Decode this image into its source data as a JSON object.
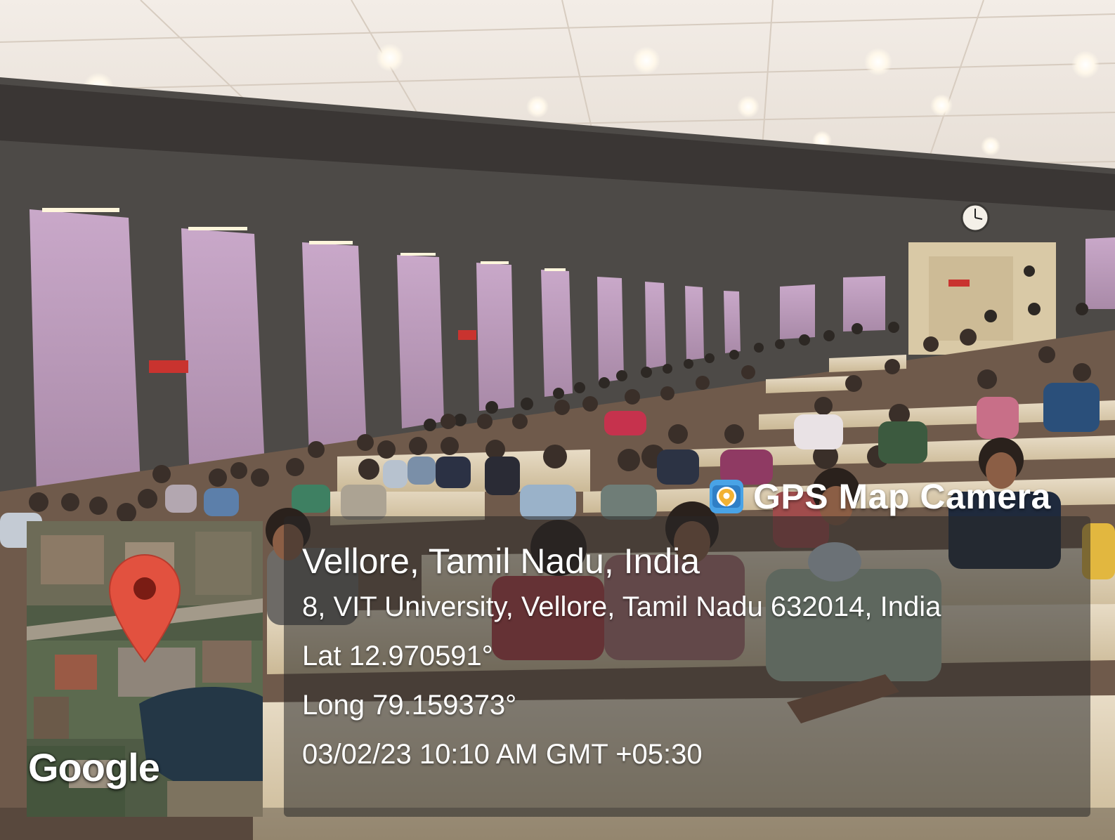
{
  "photo": {
    "subject": "lecture hall audience"
  },
  "overlay": {
    "brand": "GPS Map Camera",
    "brand_icon": "map-pin-camera-icon",
    "location": "Vellore, Tamil Nadu, India",
    "address": "8, VIT University, Vellore, Tamil Nadu 632014, India",
    "latitude": "Lat 12.970591°",
    "longitude": "Long 79.159373°",
    "datetime": "03/02/23 10:10 AM GMT +05:30",
    "map_attribution": "Google",
    "marker_icon": "map-marker-icon",
    "colors": {
      "marker": "#e2513f",
      "wall": "#b79ab9",
      "ceiling": "#ece5dd"
    }
  }
}
